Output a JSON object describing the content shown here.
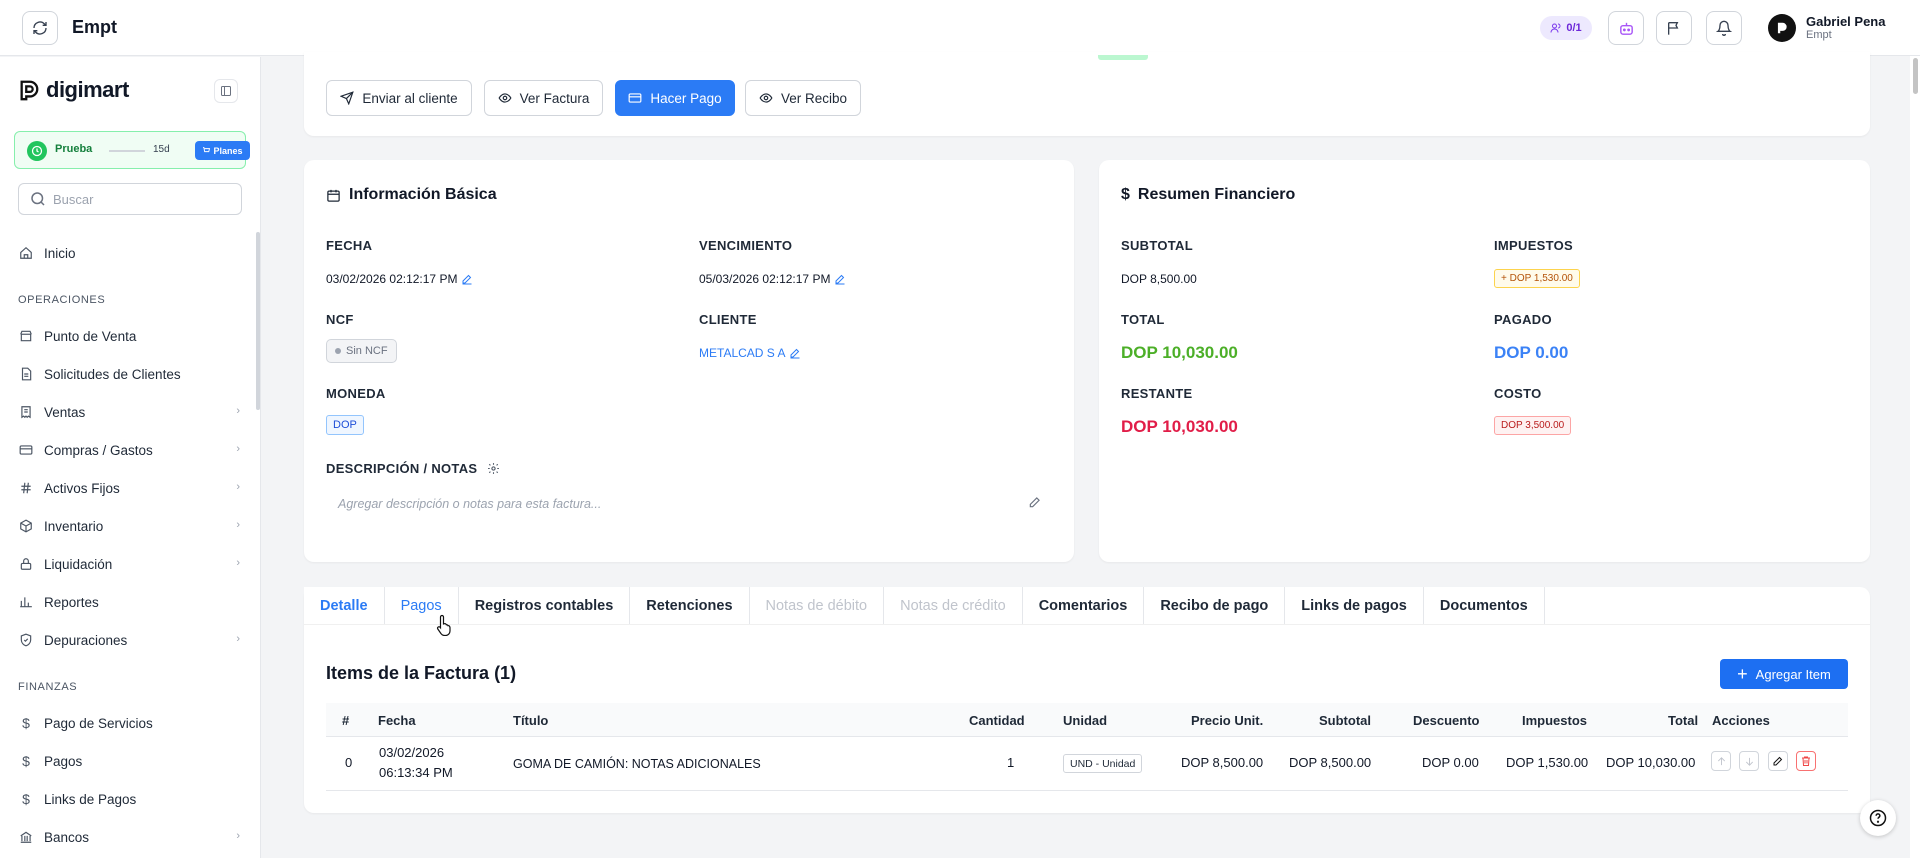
{
  "header": {
    "app_title": "Empt",
    "team_counter": "0/1",
    "user": {
      "name": "Gabriel Pena",
      "org": "Empt"
    }
  },
  "sidebar": {
    "logo_text": "digimart",
    "trial": {
      "label": "Prueba",
      "days": "15d",
      "plans_label": "Planes"
    },
    "search_placeholder": "Buscar",
    "home": "Inicio",
    "section_operations": "OPERACIONES",
    "operations": [
      {
        "label": "Punto de Venta",
        "icon": "store-icon"
      },
      {
        "label": "Solicitudes de Clientes",
        "icon": "document-icon"
      },
      {
        "label": "Ventas",
        "icon": "receipt-icon",
        "has_children": true
      },
      {
        "label": "Compras / Gastos",
        "icon": "card-icon",
        "has_children": true
      },
      {
        "label": "Activos Fijos",
        "icon": "hash-icon",
        "has_children": true
      },
      {
        "label": "Inventario",
        "icon": "box-icon",
        "has_children": true
      },
      {
        "label": "Liquidación",
        "icon": "lock-icon",
        "has_children": true
      },
      {
        "label": "Reportes",
        "icon": "chart-icon"
      },
      {
        "label": "Depuraciones",
        "icon": "shield-icon",
        "has_children": true
      }
    ],
    "section_finances": "FINANZAS",
    "finances": [
      {
        "label": "Pago de Servicios",
        "icon": "dollar-icon"
      },
      {
        "label": "Pagos",
        "icon": "dollar-icon"
      },
      {
        "label": "Links de Pagos",
        "icon": "dollar-icon"
      },
      {
        "label": "Bancos",
        "icon": "bank-icon",
        "has_children": true
      }
    ]
  },
  "actions": {
    "send": "Enviar al cliente",
    "view_invoice": "Ver Factura",
    "pay": "Hacer Pago",
    "view_receipt": "Ver Recibo"
  },
  "basic_info": {
    "title": "Información Básica",
    "fecha_label": "FECHA",
    "fecha_value": "03/02/2026 02:12:17 PM",
    "vencimiento_label": "VENCIMIENTO",
    "vencimiento_value": "05/03/2026 02:12:17 PM",
    "ncf_label": "NCF",
    "ncf_value": "Sin NCF",
    "cliente_label": "CLIENTE",
    "cliente_value": "METALCAD S A",
    "moneda_label": "MONEDA",
    "moneda_value": "DOP",
    "notes_label": "DESCRIPCIÓN / NOTAS",
    "notes_placeholder": "Agregar descripción o notas para esta factura..."
  },
  "financial_summary": {
    "title": "Resumen Financiero",
    "subtotal_label": "SUBTOTAL",
    "subtotal_value": "DOP 8,500.00",
    "impuestos_label": "IMPUESTOS",
    "impuestos_value": "+ DOP 1,530.00",
    "total_label": "TOTAL",
    "total_value": "DOP 10,030.00",
    "pagado_label": "PAGADO",
    "pagado_value": "DOP 0.00",
    "restante_label": "RESTANTE",
    "restante_value": "DOP 10,030.00",
    "costo_label": "COSTO",
    "costo_value": "DOP 3,500.00",
    "colors": {
      "total": "#4caf28",
      "pagado": "#3b82f6",
      "restante": "#e11d48"
    }
  },
  "tabs": [
    {
      "label": "Detalle",
      "state": "active"
    },
    {
      "label": "Pagos",
      "state": "hover"
    },
    {
      "label": "Registros contables",
      "state": "normal"
    },
    {
      "label": "Retenciones",
      "state": "normal"
    },
    {
      "label": "Notas de débito",
      "state": "disabled"
    },
    {
      "label": "Notas de crédito",
      "state": "disabled"
    },
    {
      "label": "Comentarios",
      "state": "normal"
    },
    {
      "label": "Recibo de pago",
      "state": "normal"
    },
    {
      "label": "Links de pagos",
      "state": "normal"
    },
    {
      "label": "Documentos",
      "state": "normal"
    }
  ],
  "items": {
    "title": "Items de la Factura (1)",
    "add_label": "Agregar Item",
    "columns": [
      "#",
      "Fecha",
      "Título",
      "Cantidad",
      "Unidad",
      "Precio Unit.",
      "Subtotal",
      "Descuento",
      "Impuestos",
      "Total",
      "Acciones"
    ],
    "rows": [
      {
        "num": "0",
        "date": "03/02/2026",
        "time": "06:13:34 PM",
        "title": "GOMA DE CAMIÓN: NOTAS ADICIONALES",
        "quantity": "1",
        "unit": "UND - Unidad",
        "unit_price": "DOP 8,500.00",
        "subtotal": "DOP 8,500.00",
        "discount": "DOP 0.00",
        "taxes": "DOP 1,530.00",
        "total": "DOP 10,030.00"
      }
    ]
  }
}
